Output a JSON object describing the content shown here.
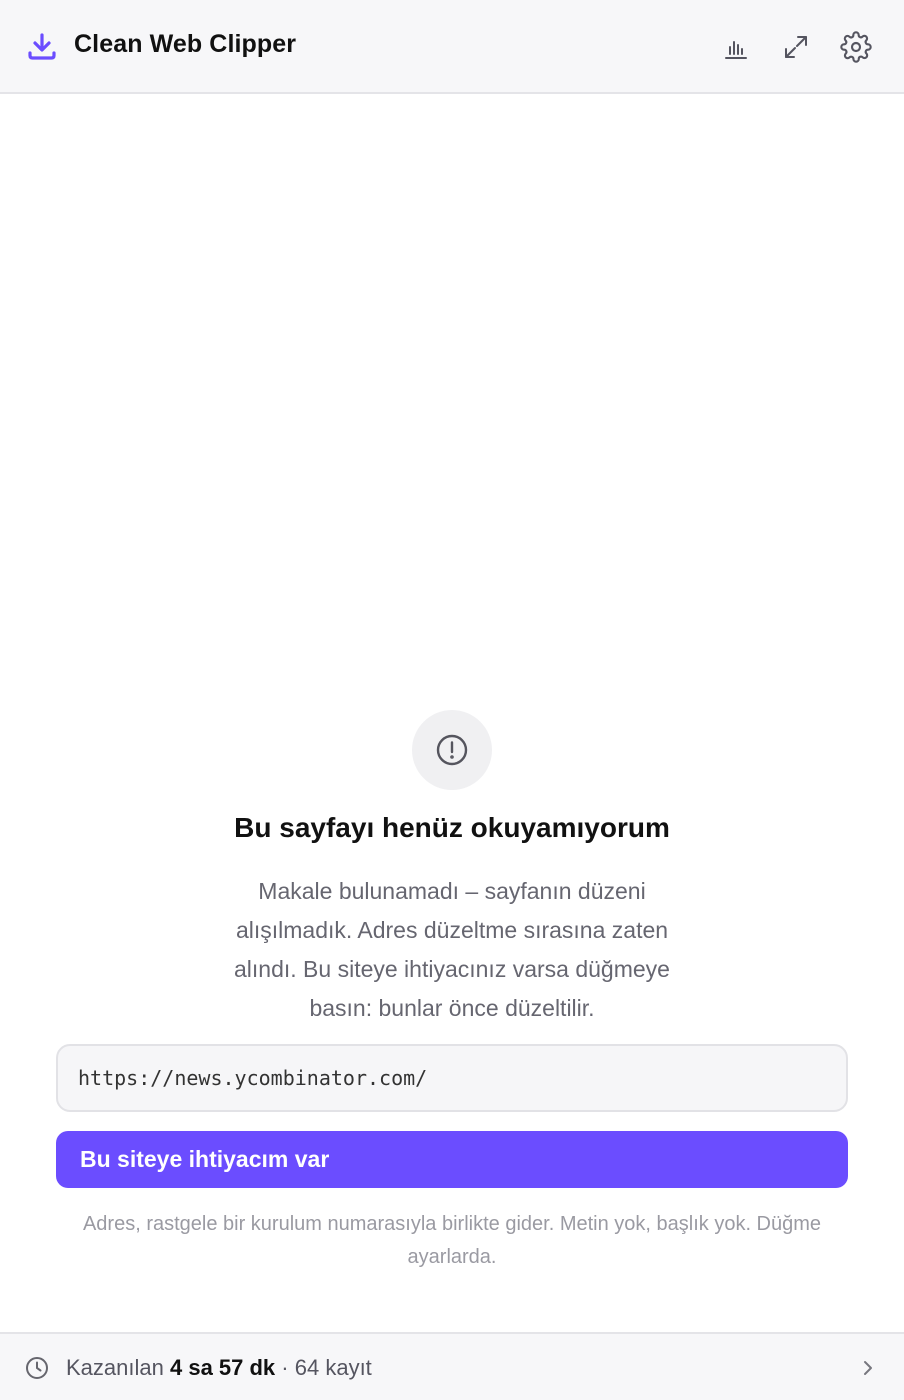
{
  "header": {
    "title": "Clean Web Clipper",
    "brand_color": "#6b4dff",
    "icons": [
      "download-icon",
      "bar-chart-icon",
      "expand-icon",
      "gear-icon"
    ]
  },
  "notice": {
    "icon": "alert-circle-icon",
    "title": "Bu sayfayı henüz okuyamıyorum",
    "body": "Makale bulunamadı – sayfanın düzeni alışılmadık. Adres düzeltme sırasına zaten alındı. Bu siteye ihtiyacınız varsa düğmeye basın: bunlar önce düzeltilir.",
    "url": "https://news.ycombinator.com/",
    "button_label": "Bu siteye ihtiyacım var",
    "fineprint": "Adres, rastgele bir kurulum numarasıyla birlikte gider. Metin yok, başlık yok. Düğme ayarlarda."
  },
  "footer": {
    "icon": "clock-icon",
    "saved_label": "Kazanılan",
    "saved_value": "4 sa 57 dk",
    "separator": "·",
    "records": "64 kayıt"
  }
}
